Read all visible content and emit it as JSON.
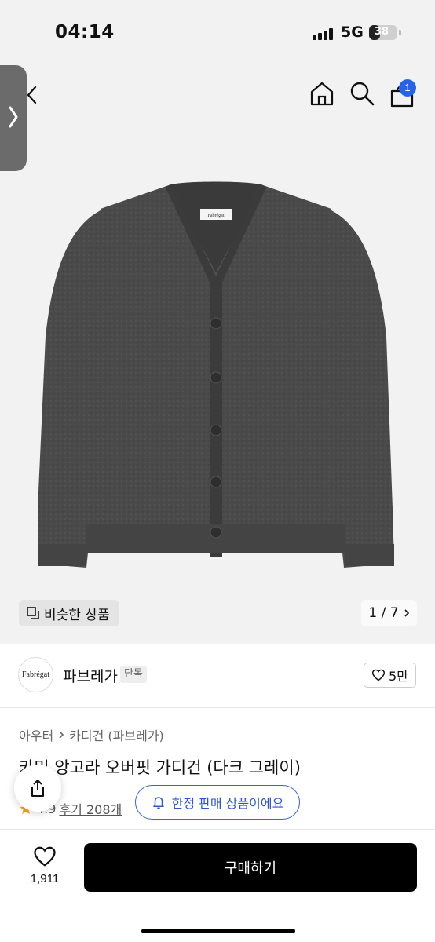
{
  "status_bar": {
    "time": "04:14",
    "network": "5G",
    "battery": "38",
    "battery_level": 0.38
  },
  "header": {
    "cart_count": "1",
    "icons": [
      "back-icon",
      "home-icon",
      "search-icon",
      "cart-icon",
      "side-panel-chevron-icon"
    ]
  },
  "gallery": {
    "similar_label": "비슷한 상품",
    "pager": "1 / 7",
    "image_tag": "Fabrégat"
  },
  "brand": {
    "logo_text": "Fabrégat",
    "name": "파브레가",
    "badge": "단독",
    "likes": "5만"
  },
  "product": {
    "breadcrumb_1": "아우터",
    "breadcrumb_2": "카디건 (파브레가)",
    "title": "카밍 앙고라 오버핏 가디건 (다크 그레이)",
    "rating": "4.9",
    "reviews": "후기 208개",
    "limited_label": "한정 판매 상품이에요"
  },
  "bottom": {
    "wish_count": "1,911",
    "buy_label": "구매하기"
  },
  "colors": {
    "accent_blue": "#2563eb",
    "star": "#f5a524",
    "cardigan": "#4a4a4a"
  }
}
